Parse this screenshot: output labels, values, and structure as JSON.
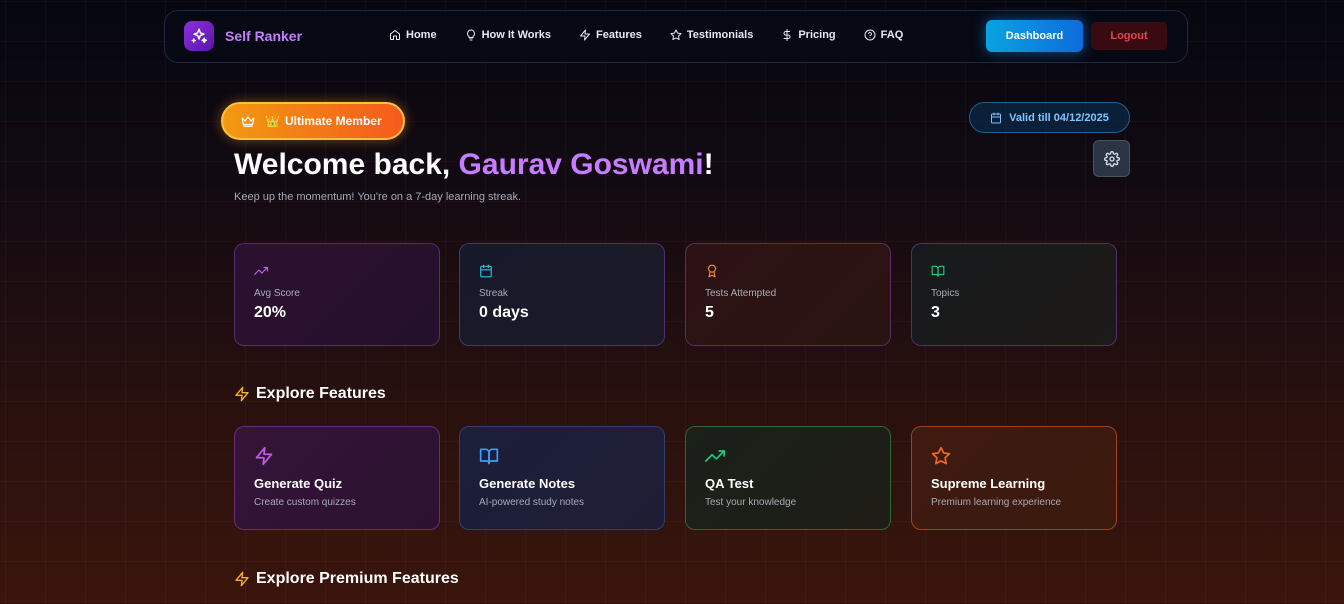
{
  "nav": {
    "brand": "Self Ranker",
    "logo_icon": "sparkles-icon",
    "links": [
      {
        "label": "Home",
        "icon": "home-icon"
      },
      {
        "label": "How It Works",
        "icon": "lightbulb-icon"
      },
      {
        "label": "Features",
        "icon": "zap-icon"
      },
      {
        "label": "Testimonials",
        "icon": "star-icon"
      },
      {
        "label": "Pricing",
        "icon": "dollar-icon"
      },
      {
        "label": "FAQ",
        "icon": "help-circle-icon"
      }
    ],
    "dashboard_label": "Dashboard",
    "logout_label": "Logout"
  },
  "hero": {
    "member_emoji": "👑",
    "member_label": "Ultimate Member",
    "valid_label": "Valid till 04/12/2025",
    "welcome_prefix": "Welcome back, ",
    "user_name": "Gaurav Goswami",
    "welcome_suffix": "!",
    "streak_message": "Keep up the momentum! You're on a 7-day learning streak."
  },
  "stats": [
    {
      "label": "Avg Score",
      "value": "20%",
      "icon": "trending-up-icon",
      "color": "#c45bf0"
    },
    {
      "label": "Streak",
      "value": "0 days",
      "icon": "calendar-icon",
      "color": "#22c3d6"
    },
    {
      "label": "Tests Attempted",
      "value": "5",
      "icon": "award-icon",
      "color": "#f0873a"
    },
    {
      "label": "Topics",
      "value": "3",
      "icon": "book-open-icon",
      "color": "#22c77a"
    }
  ],
  "sections": {
    "explore": "Explore Features",
    "premium": "Explore Premium Features"
  },
  "features": [
    {
      "title": "Generate Quiz",
      "desc": "Create custom quizzes",
      "icon": "zap-icon",
      "color": "#c45bf0"
    },
    {
      "title": "Generate Notes",
      "desc": "AI-powered study notes",
      "icon": "book-open-icon",
      "color": "#3aa0ff"
    },
    {
      "title": "QA Test",
      "desc": "Test your knowledge",
      "icon": "trending-up-icon",
      "color": "#22c77a"
    },
    {
      "title": "Supreme Learning",
      "desc": "Premium learning experience",
      "icon": "star-icon",
      "color": "#f26a22"
    }
  ],
  "colors": {
    "accent_purple": "#c77dff",
    "dashboard_blue": "#0a8de0",
    "logout_red": "#e0484e",
    "member_orange": "#f2801a",
    "section_icon_yellow": "#f5b52a"
  }
}
